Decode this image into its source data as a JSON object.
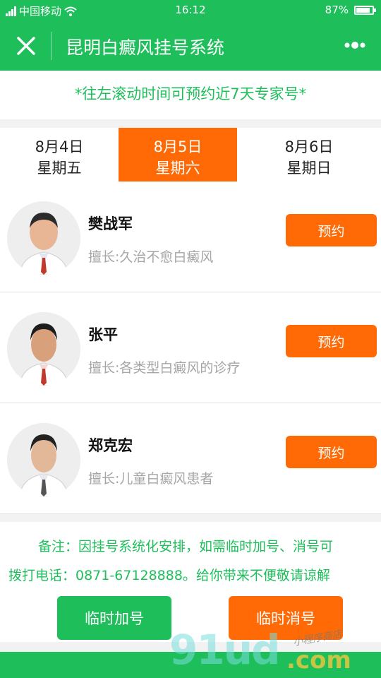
{
  "status": {
    "carrier": "中国移动",
    "time": "16:12",
    "battery": "87%",
    "battery_level": 0.87
  },
  "header": {
    "title": "昆明白癜风挂号系统"
  },
  "notice": "*往左滚动时间可预约近7天专家号*",
  "dates": [
    {
      "date": "8月4日",
      "weekday": "星期五"
    },
    {
      "date": "8月5日",
      "weekday": "星期六"
    },
    {
      "date": "8月6日",
      "weekday": "星期日"
    }
  ],
  "doctors": [
    {
      "name": "樊战军",
      "skill": "擅长:久治不愈白癜风",
      "button": "预约"
    },
    {
      "name": "张平",
      "skill": "擅长:各类型白癜风的诊疗",
      "button": "预约"
    },
    {
      "name": "郑克宏",
      "skill": "擅长:儿童白癜风患者",
      "button": "预约"
    }
  ],
  "remark": {
    "line1": "备注：因挂号系统化安排，如需临时加号、消号可",
    "line2": "拨打电话：0871-67128888。给你带来不便敬请谅解"
  },
  "buttons": {
    "add": "临时加号",
    "cancel": "临时消号"
  },
  "watermark": {
    "main": "91ud",
    "domain": ".com",
    "tag": "小程序商店"
  },
  "colors": {
    "green": "#1ebf5b",
    "orange": "#ff6a06"
  }
}
